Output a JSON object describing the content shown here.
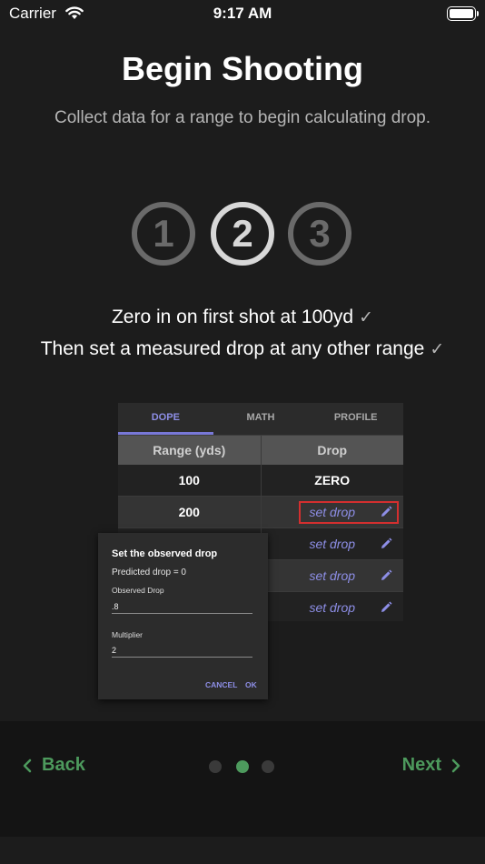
{
  "status_bar": {
    "carrier": "Carrier",
    "time": "9:17 AM"
  },
  "header": {
    "title": "Begin Shooting",
    "subtitle": "Collect data for a range to begin calculating drop."
  },
  "steps": [
    {
      "label": "1",
      "state": "inactive"
    },
    {
      "label": "2",
      "state": "current"
    },
    {
      "label": "3",
      "state": "inactive"
    }
  ],
  "checklist": [
    {
      "text": "Zero in on first shot at 100yd",
      "done": true
    },
    {
      "text": "Then set a measured drop at any other range",
      "done": true
    }
  ],
  "illustration": {
    "tabs": [
      "DOPE",
      "MATH",
      "PROFILE"
    ],
    "active_tab": "DOPE",
    "columns": [
      "Range (yds)",
      "Drop"
    ],
    "rows": [
      {
        "range": "100",
        "drop": "ZERO"
      },
      {
        "range": "200",
        "drop": "set drop"
      },
      {
        "range": "",
        "drop": "set drop"
      },
      {
        "range": "",
        "drop": "set drop"
      },
      {
        "range": "",
        "drop": "set drop"
      }
    ],
    "dialog": {
      "title": "Set the observed drop",
      "predicted": "Predicted drop = 0",
      "observed_label": "Observed Drop",
      "observed_value": ".8",
      "multiplier_label": "Multiplier",
      "multiplier_value": "2",
      "cancel": "CANCEL",
      "ok": "OK"
    }
  },
  "nav": {
    "back": "Back",
    "next": "Next",
    "page_count": 3,
    "current_page": 2
  },
  "colors": {
    "accent_green": "#4d9a5d",
    "accent_purple": "#8d8ee6",
    "highlight_red": "#d32f2f"
  }
}
